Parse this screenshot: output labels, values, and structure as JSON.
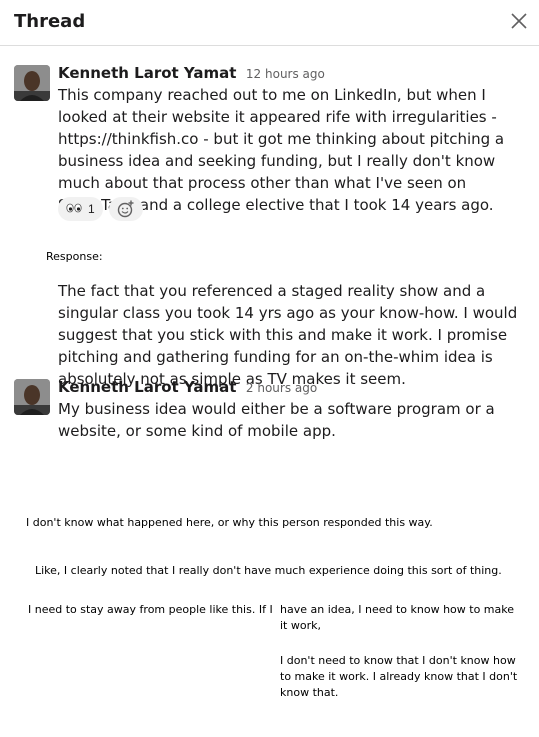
{
  "header": {
    "title": "Thread"
  },
  "messages": [
    {
      "author": "Kenneth Larot Yamat",
      "time": "12 hours ago",
      "text": "This company reached out to me on LinkedIn, but when I looked at their website it appeared rife with irregularities - https://thinkfish.co - but it got me thinking about pitching a business idea and seeking funding, but I really don't know much about that process other than what I've seen on SharkTank and a college elective that I took 14 years ago.",
      "reactions": [
        {
          "icon": "eyes-icon",
          "count": "1"
        }
      ]
    },
    {
      "author": "Kenneth Larot Yamat",
      "time": "2 hours ago",
      "text": "My business idea would either be a software program or a website, or some kind of mobile app."
    }
  ],
  "response": {
    "label": "Response:",
    "text": "The fact that you referenced a staged reality show and a singular class you took 14 yrs ago as your know-how. I would suggest that you stick with this and make it work. I promise pitching and gathering funding for an on-the-whim idea is absolutely not as simple as TV makes it seem."
  },
  "notes": {
    "note1": "I don't know what happened here, or why this person responded this way.",
    "note2": "Like, I clearly noted that I really don't have much experience doing this sort of thing.",
    "note3a": "I need to stay away from people like this. If I",
    "note3b": "have an idea, I need to know how to make it work,",
    "note4": "I don't need to know that I don't know how to make it work. I already know that I don't know that."
  }
}
